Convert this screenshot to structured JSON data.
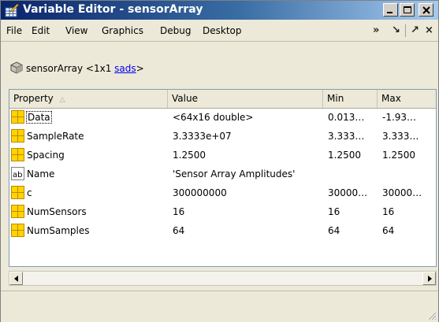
{
  "window": {
    "title": "Variable Editor - sensorArray",
    "icon": "variable-editor-icon"
  },
  "menu": [
    "File",
    "Edit",
    "View",
    "Graphics",
    "Debug",
    "Desktop"
  ],
  "dock_controls": {
    "more": "»",
    "undock": "↘",
    "dock": "↗",
    "close": "×"
  },
  "breadcrumb": {
    "object_icon": "object-icon",
    "variable": "sensorArray",
    "size_prefix": "<1x1 ",
    "class_link": "sads",
    "size_suffix": ">"
  },
  "table": {
    "columns": [
      "Property",
      "Value",
      "Min",
      "Max"
    ],
    "sort_indicator": "△",
    "rows": [
      {
        "icon": "numeric-grid-icon",
        "property": "Data",
        "value": "<64x16 double>",
        "min": "0.013…",
        "max": "-1.93…"
      },
      {
        "icon": "numeric-grid-icon",
        "property": "SampleRate",
        "value": "3.3333e+07",
        "min": "3.333…",
        "max": "3.333…"
      },
      {
        "icon": "numeric-grid-icon",
        "property": "Spacing",
        "value": "1.2500",
        "min": "1.2500",
        "max": "1.2500"
      },
      {
        "icon": "text-ab-icon",
        "property": "Name",
        "value": "'Sensor Array Amplitudes'",
        "min": "",
        "max": ""
      },
      {
        "icon": "numeric-grid-icon",
        "property": "c",
        "value": "300000000",
        "min": "30000…",
        "max": "30000…"
      },
      {
        "icon": "numeric-grid-icon",
        "property": "NumSensors",
        "value": "16",
        "min": "16",
        "max": "16"
      },
      {
        "icon": "numeric-grid-icon",
        "property": "NumSamples",
        "value": "64",
        "min": "64",
        "max": "64"
      }
    ]
  },
  "colors": {
    "title_bar_start": "#0a246a",
    "title_bar_end": "#a6caf0",
    "numeric_icon_fill": "#ffd400",
    "link": "#0000ee"
  }
}
